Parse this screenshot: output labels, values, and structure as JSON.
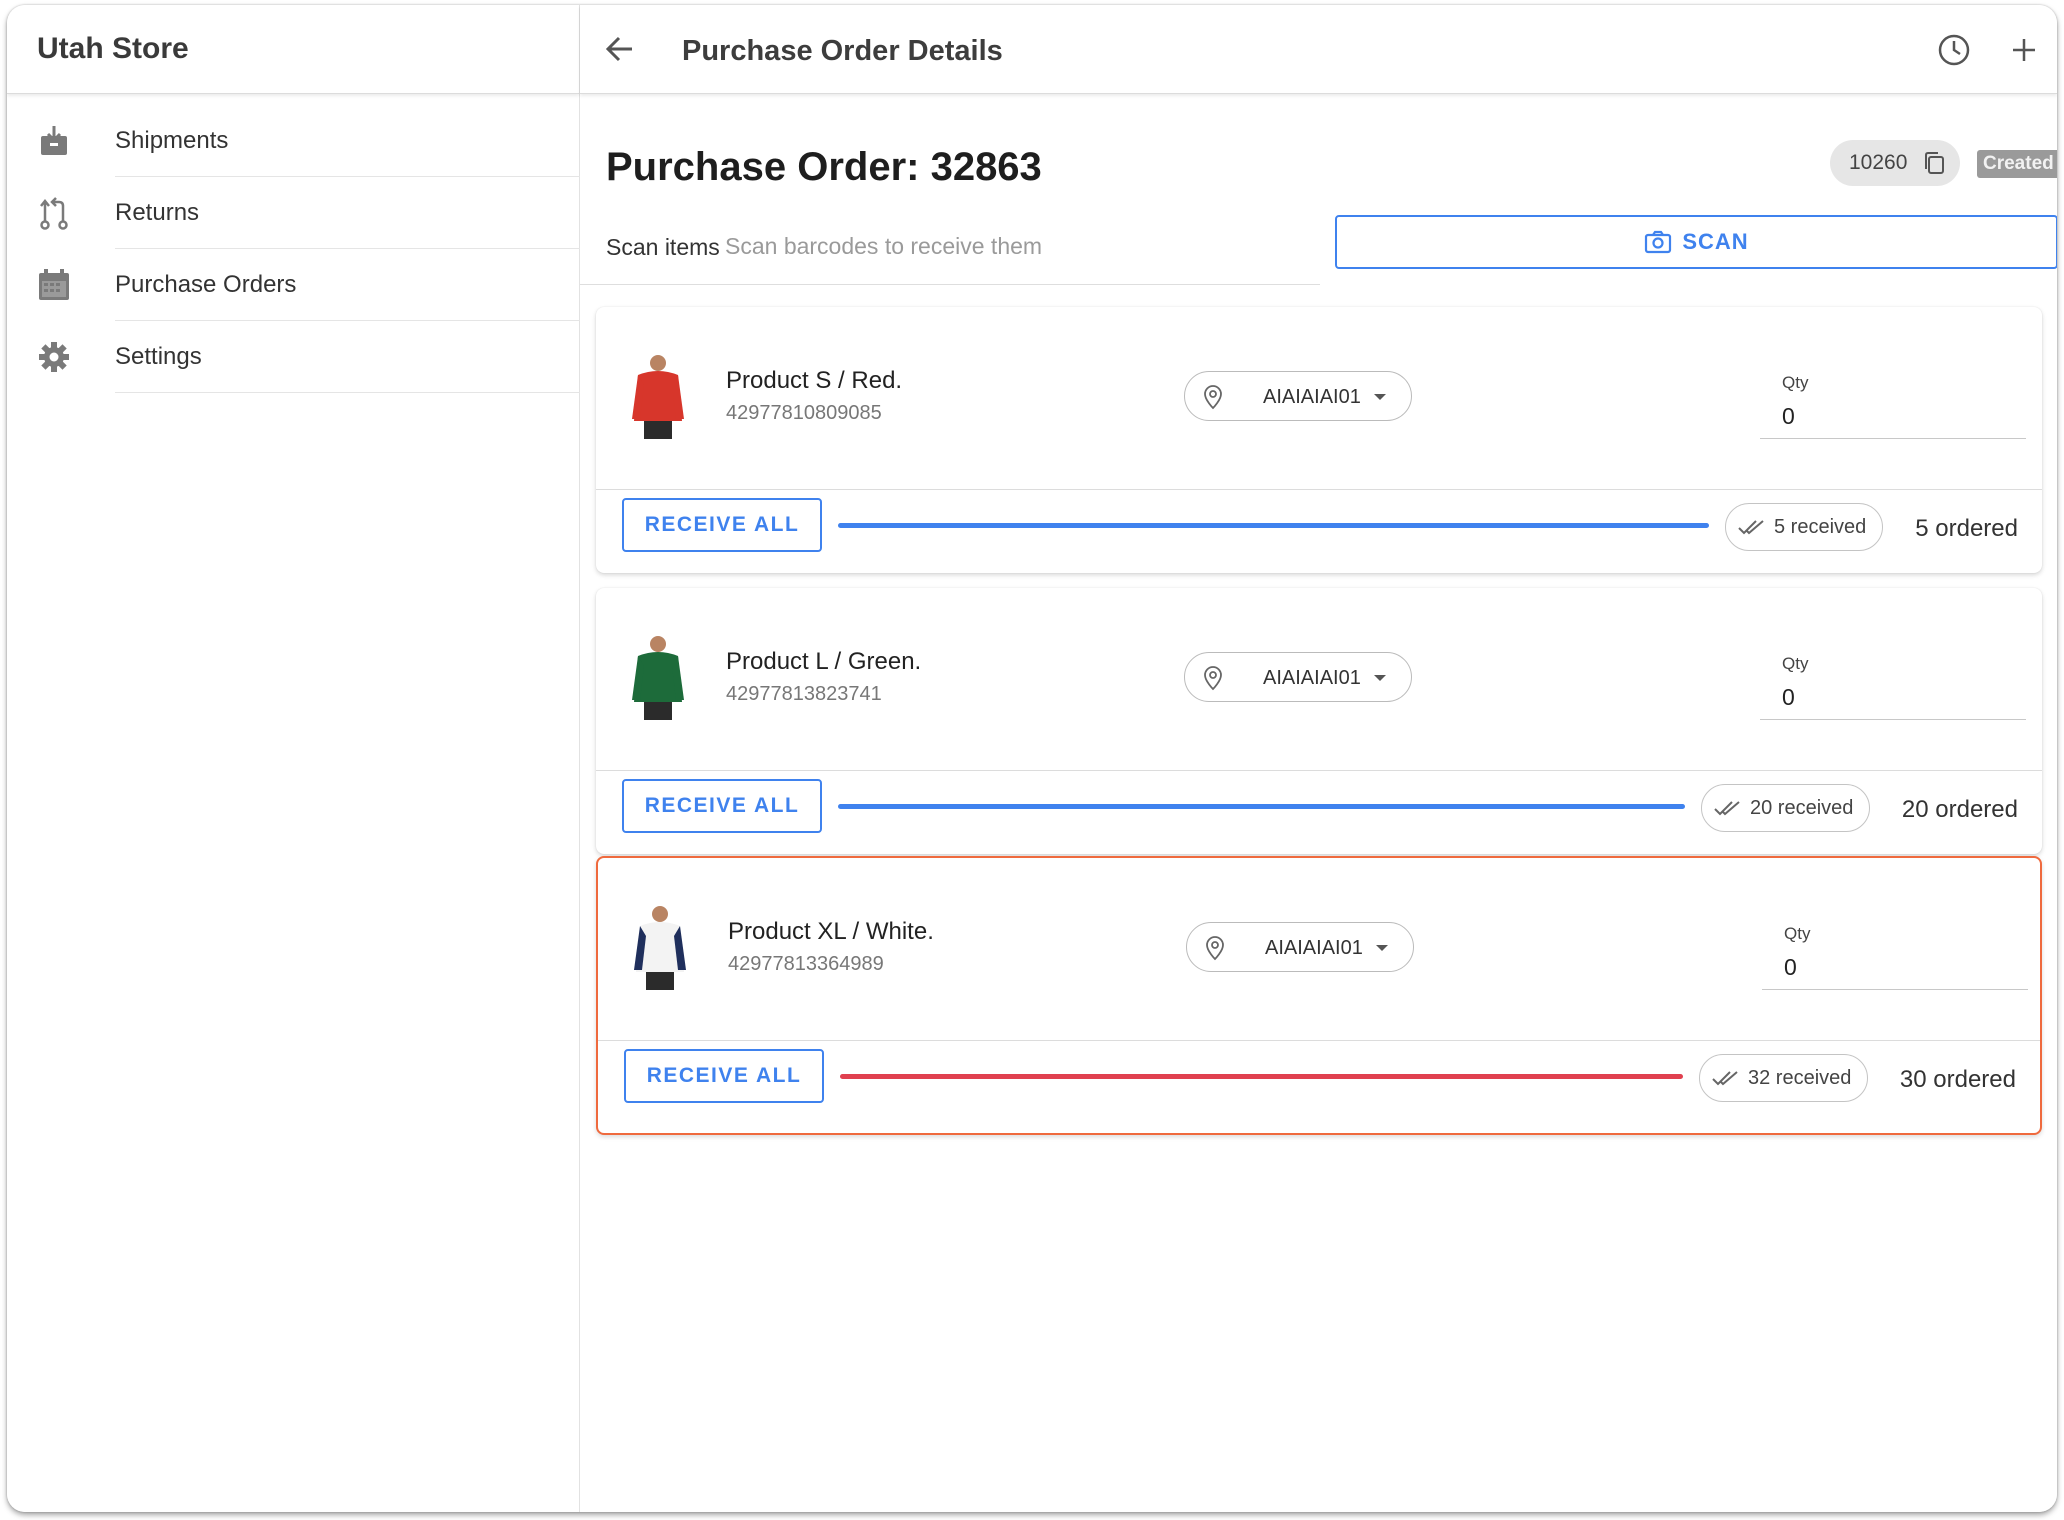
{
  "sidebar": {
    "store_name": "Utah Store",
    "items": [
      {
        "label": "Shipments",
        "icon": "download-box-icon"
      },
      {
        "label": "Returns",
        "icon": "git-compare-icon"
      },
      {
        "label": "Purchase Orders",
        "icon": "calendar-icon"
      },
      {
        "label": "Settings",
        "icon": "gear-icon"
      }
    ]
  },
  "header": {
    "title": "Purchase Order Details"
  },
  "order": {
    "title": "Purchase Order: 32863",
    "external_id": "10260",
    "status": "Created"
  },
  "scan": {
    "label": "Scan items",
    "placeholder": "Scan barcodes to receive them",
    "button_label": "SCAN"
  },
  "items": [
    {
      "name": "Product S / Red.",
      "sku": "42977810809085",
      "location": "AIAIAIAI01",
      "qty_label": "Qty",
      "qty": "0",
      "receive_all_label": "RECEIVE ALL",
      "received_label": "5 received",
      "ordered_label": "5 ordered",
      "received": 5,
      "ordered": 5,
      "shirt_color": "#d7362b",
      "over_received": false
    },
    {
      "name": "Product L / Green.",
      "sku": "42977813823741",
      "location": "AIAIAIAI01",
      "qty_label": "Qty",
      "qty": "0",
      "receive_all_label": "RECEIVE ALL",
      "received_label": "20 received",
      "ordered_label": "20 ordered",
      "received": 20,
      "ordered": 20,
      "shirt_color": "#1d6b3a",
      "over_received": false
    },
    {
      "name": "Product XL / White.",
      "sku": "42977813364989",
      "location": "AIAIAIAI01",
      "qty_label": "Qty",
      "qty": "0",
      "receive_all_label": "RECEIVE ALL",
      "received_label": "32 received",
      "ordered_label": "30 ordered",
      "received": 32,
      "ordered": 30,
      "shirt_color": "#f3f3f3",
      "over_received": true
    }
  ],
  "colors": {
    "accent": "#3f82ee",
    "error_border": "#ef6a3e",
    "error_progress": "#e0404f",
    "status_badge": "#9a9a9a"
  }
}
